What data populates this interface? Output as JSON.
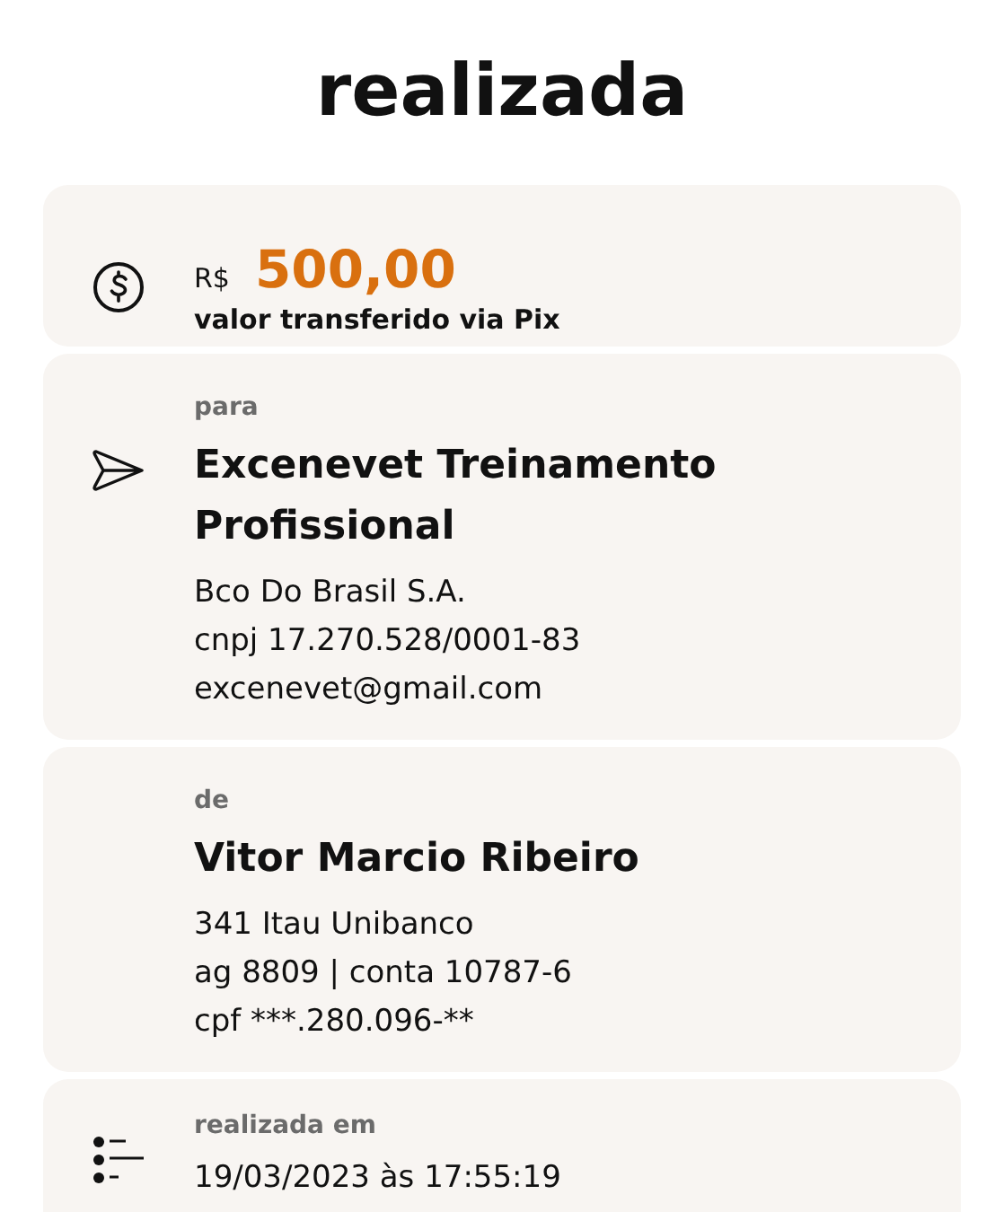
{
  "title": [
    "realizada"
  ],
  "amount": {
    "currency": "R$",
    "value": "500,00",
    "caption": "valor transferido via Pix"
  },
  "parties": [
    {
      "label": "para",
      "name": "Excenevet Treinamento Profissional",
      "details": [
        " Bco Do Brasil S.A.",
        "cnpj 17.270.528/0001-83",
        "excenevet@gmail.com"
      ],
      "kind": "recipient"
    },
    {
      "label": "de",
      "name": "Vitor Marcio Ribeiro",
      "details": [
        "341 Itau Unibanco",
        "ag 8809 | conta 10787-6",
        "cpf ***.280.096-**"
      ],
      "kind": "sender"
    }
  ],
  "date": {
    "label": "realizada em",
    "value": "19/03/2023 às 17:55:19"
  }
}
